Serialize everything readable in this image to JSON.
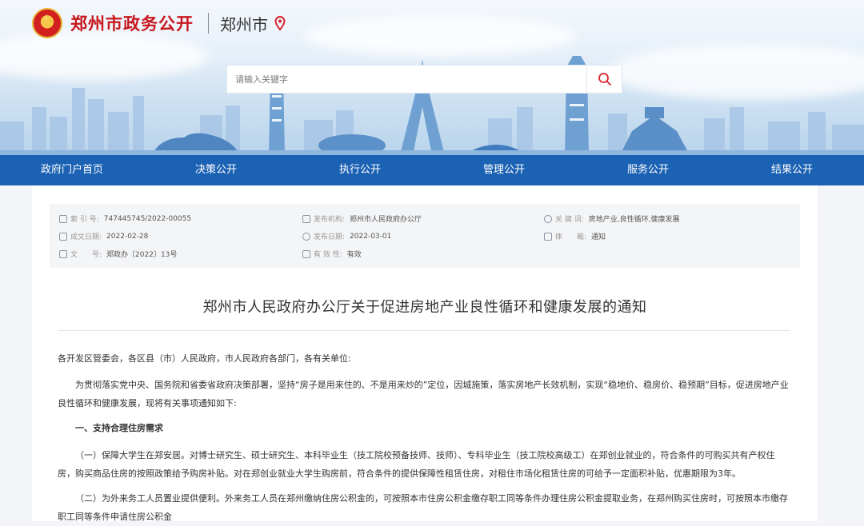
{
  "header": {
    "site_name": "郑州市政务公开",
    "city": "郑州市",
    "search_placeholder": "请输入关键字"
  },
  "nav": {
    "items": [
      "政府门户首页",
      "决策公开",
      "执行公开",
      "管理公开",
      "服务公开",
      "结果公开"
    ]
  },
  "meta": {
    "index_label": "索 引 号:",
    "index_value": "747445745/2022-00055",
    "agency_label": "发布机构:",
    "agency_value": "郑州市人民政府办公厅",
    "keywords_label": "关 键 词:",
    "keywords_value": "房地产业,良性循环,健康发展",
    "created_label": "成文日期:",
    "created_value": "2022-02-28",
    "published_label": "发布日期:",
    "published_value": "2022-03-01",
    "genre_label": "体　　裁:",
    "genre_value": "通知",
    "docno_label": "文　　号:",
    "docno_value": "郑政办〔2022〕13号",
    "validity_label": "有 效 性:",
    "validity_value": "有效"
  },
  "document": {
    "title": "郑州市人民政府办公厅关于促进房地产业良性循环和健康发展的通知",
    "salutation": "各开发区管委会，各区县（市）人民政府，市人民政府各部门，各有关单位:",
    "para1": "为贯彻落实党中央、国务院和省委省政府决策部署，坚持“房子是用来住的、不是用来炒的”定位，因城施策，落实房地产长效机制，实现“稳地价、稳房价、稳预期”目标，促进房地产业良性循环和健康发展，现将有关事项通知如下:",
    "heading1": "一、支持合理住房需求",
    "para2": "（一）保障大学生在郑安居。对博士研究生、硕士研究生、本科毕业生（技工院校预备技师、技师）、专科毕业生（技工院校高级工）在郑创业就业的，符合条件的可购买共有产权住房，购买商品住房的按照政策给予购房补贴。对在郑创业就业大学生购房前，符合条件的提供保障性租赁住房，对租住市场化租赁住房的可给予一定面积补贴，优惠期限为3年。",
    "para3": "（二）为外来务工人员置业提供便利。外来务工人员在郑州缴纳住房公积金的，可按照本市住房公积金缴存职工同等条件办理住房公积金提取业务，在郑州购买住房时，可按照本市缴存职工同等条件申请住房公积金"
  },
  "colors": {
    "nav_bg": "#1c62b4",
    "brand_red": "#c8161d"
  }
}
